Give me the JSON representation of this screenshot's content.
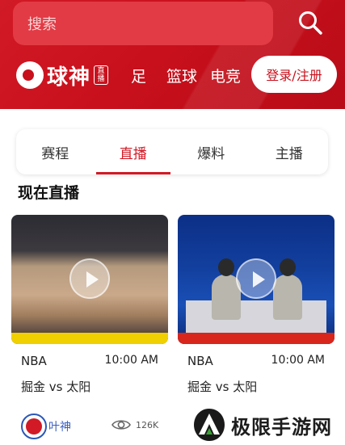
{
  "header": {
    "search_placeholder": "搜索",
    "logo_text": "球神",
    "logo_badge": "直播",
    "nav": [
      "足",
      "篮球",
      "电竞"
    ],
    "login_label": "登录/注册"
  },
  "tabs": [
    "赛程",
    "直播",
    "爆料",
    "主播"
  ],
  "active_tab": "直播",
  "section_title": "现在直播",
  "cards": [
    {
      "league": "NBA",
      "time": "10:00 AM",
      "match": "掘金 vs 太阳"
    },
    {
      "league": "NBA",
      "time": "10:00 AM",
      "match": "掘金 vs 太阳"
    }
  ],
  "author": {
    "name": "叶神",
    "views": "126K"
  },
  "watermark": {
    "text": "极限手游网"
  },
  "colors": {
    "brand_red": "#d11a26",
    "accent_blue": "#3a5fc0"
  }
}
